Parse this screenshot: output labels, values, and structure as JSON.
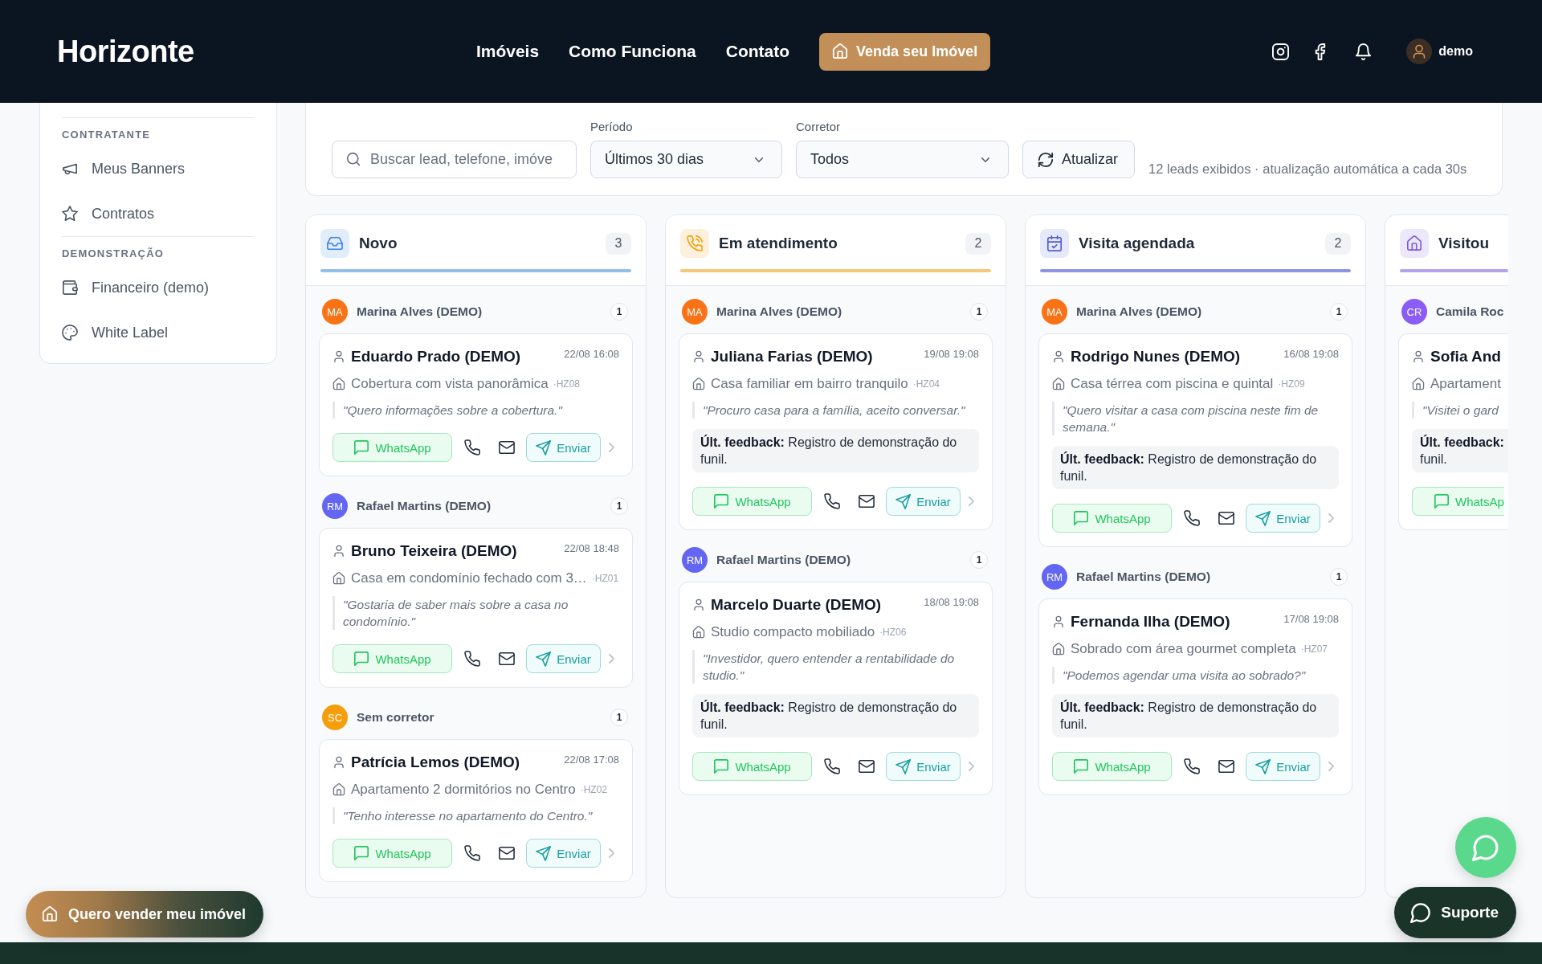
{
  "header": {
    "logo": "Horizonte",
    "nav": [
      {
        "label": "Imóveis"
      },
      {
        "label": "Como Funciona"
      },
      {
        "label": "Contato"
      }
    ],
    "cta": "Venda seu Imóvel",
    "user": "demo"
  },
  "sidebar": {
    "sections": [
      {
        "title": "CONTRATANTE",
        "items": [
          {
            "kind": "banners",
            "label": "Meus Banners"
          },
          {
            "kind": "contracts",
            "label": "Contratos"
          }
        ]
      },
      {
        "title": "DEMONSTRAÇÃO",
        "items": [
          {
            "kind": "finance",
            "label": "Financeiro (demo)"
          },
          {
            "kind": "branding",
            "label": "White Label"
          }
        ]
      }
    ]
  },
  "filters": {
    "search": {
      "placeholder": "Buscar lead, telefone, imóve"
    },
    "period": {
      "label": "Período",
      "value": "Últimos 30 dias"
    },
    "broker": {
      "label": "Corretor",
      "value": "Todos"
    },
    "refresh": "Atualizar",
    "info": "12 leads exibidos · atualização automática a cada 30s"
  },
  "board": {
    "columns": [
      {
        "kind": "new",
        "title": "Novo",
        "count": "3",
        "color": "#93bfe8",
        "groups": [
          {
            "initials": "MA",
            "color": "#f97316",
            "name": "Marina Alves (DEMO)",
            "count": "1",
            "leads": [
              {
                "name": "Eduardo Prado (DEMO)",
                "date": "22/08 16:08",
                "property": "Cobertura com vista panorâmica",
                "code": "·HZ08",
                "quote": "\"Quero informações sobre a cobertura.\"",
                "actions": [
                  {
                    "kind": "whatsapp",
                    "label": "WhatsApp"
                  },
                  {
                    "kind": "call"
                  },
                  {
                    "kind": "email"
                  },
                  {
                    "kind": "send",
                    "label": "Enviar"
                  },
                  {
                    "kind": "more"
                  }
                ]
              }
            ]
          },
          {
            "initials": "RM",
            "color": "#6366f1",
            "name": "Rafael Martins (DEMO)",
            "count": "1",
            "leads": [
              {
                "name": "Bruno Teixeira (DEMO)",
                "date": "22/08 18:48",
                "property": "Casa em condomínio fechado com 3…",
                "code": "·HZ01",
                "quote": "\"Gostaria de saber mais sobre a casa no condomínio.\"",
                "actions": [
                  {
                    "kind": "whatsapp",
                    "label": "WhatsApp"
                  },
                  {
                    "kind": "call"
                  },
                  {
                    "kind": "email"
                  },
                  {
                    "kind": "send",
                    "label": "Enviar"
                  },
                  {
                    "kind": "more"
                  }
                ]
              }
            ]
          },
          {
            "initials": "SC",
            "color": "#f59e0b",
            "name": "Sem corretor",
            "count": "1",
            "leads": [
              {
                "name": "Patrícia Lemos (DEMO)",
                "date": "22/08 17:08",
                "property": "Apartamento 2 dormitórios no Centro",
                "code": "·HZ02",
                "quote": "\"Tenho interesse no apartamento do Centro.\"",
                "actions": [
                  {
                    "kind": "whatsapp",
                    "label": "WhatsApp"
                  },
                  {
                    "kind": "call"
                  },
                  {
                    "kind": "email"
                  },
                  {
                    "kind": "send",
                    "label": "Enviar"
                  },
                  {
                    "kind": "more"
                  }
                ]
              }
            ]
          }
        ]
      },
      {
        "kind": "attending",
        "title": "Em atendimento",
        "count": "2",
        "color": "#f4c77b",
        "groups": [
          {
            "initials": "MA",
            "color": "#f97316",
            "name": "Marina Alves (DEMO)",
            "count": "1",
            "leads": [
              {
                "name": "Juliana Farias (DEMO)",
                "date": "19/08 19:08",
                "property": "Casa familiar em bairro tranquilo",
                "code": "·HZ04",
                "quote": "\"Procuro casa para a família, aceito conversar.\"",
                "feedback": "**Últ. feedback:** Registro de demonstração do funil.",
                "actions": [
                  {
                    "kind": "whatsapp",
                    "label": "WhatsApp"
                  },
                  {
                    "kind": "call"
                  },
                  {
                    "kind": "email"
                  },
                  {
                    "kind": "send",
                    "label": "Enviar"
                  },
                  {
                    "kind": "more"
                  }
                ]
              }
            ]
          },
          {
            "initials": "RM",
            "color": "#6366f1",
            "name": "Rafael Martins (DEMO)",
            "count": "1",
            "leads": [
              {
                "name": "Marcelo Duarte (DEMO)",
                "date": "18/08 19:08",
                "property": "Studio compacto mobiliado",
                "code": "·HZ06",
                "quote": "\"Investidor, quero entender a rentabilidade do studio.\"",
                "feedback": "**Últ. feedback:** Registro de demonstração do funil.",
                "actions": [
                  {
                    "kind": "whatsapp",
                    "label": "WhatsApp"
                  },
                  {
                    "kind": "call"
                  },
                  {
                    "kind": "email"
                  },
                  {
                    "kind": "send",
                    "label": "Enviar"
                  },
                  {
                    "kind": "more"
                  }
                ]
              }
            ]
          }
        ]
      },
      {
        "kind": "scheduled",
        "title": "Visita agendada",
        "count": "2",
        "color": "#8d95e3",
        "groups": [
          {
            "initials": "MA",
            "color": "#f97316",
            "name": "Marina Alves (DEMO)",
            "count": "1",
            "leads": [
              {
                "name": "Rodrigo Nunes (DEMO)",
                "date": "16/08 19:08",
                "property": "Casa térrea com piscina e quintal",
                "code": "·HZ09",
                "quote": "\"Quero visitar a casa com piscina neste fim de semana.\"",
                "feedback": "**Últ. feedback:** Registro de demonstração do funil.",
                "actions": [
                  {
                    "kind": "whatsapp",
                    "label": "WhatsApp"
                  },
                  {
                    "kind": "call"
                  },
                  {
                    "kind": "email"
                  },
                  {
                    "kind": "send",
                    "label": "Enviar"
                  },
                  {
                    "kind": "more"
                  }
                ]
              }
            ]
          },
          {
            "initials": "RM",
            "color": "#6366f1",
            "name": "Rafael Martins (DEMO)",
            "count": "1",
            "leads": [
              {
                "name": "Fernanda Ilha (DEMO)",
                "date": "17/08 19:08",
                "property": "Sobrado com área gourmet completa",
                "code": "·HZ07",
                "quote": "\"Podemos agendar uma visita ao sobrado?\"",
                "feedback": "**Últ. feedback:** Registro de demonstração do funil.",
                "actions": [
                  {
                    "kind": "whatsapp",
                    "label": "WhatsApp"
                  },
                  {
                    "kind": "call"
                  },
                  {
                    "kind": "email"
                  },
                  {
                    "kind": "send",
                    "label": "Enviar"
                  },
                  {
                    "kind": "more"
                  }
                ]
              }
            ]
          }
        ]
      },
      {
        "kind": "visited",
        "title": "Visitou",
        "color": "#b3a3ea",
        "groups": [
          {
            "initials": "CR",
            "color": "#8b5cf6",
            "name": "Camila Roc",
            "leads": [
              {
                "name": "Sofia And",
                "property": "Apartament",
                "quote": "\"Visitei o gard",
                "feedback": "**Últ. feedback:**\nfunil.",
                "actions": [
                  {
                    "kind": "whatsapp",
                    "label": "WhatsAp"
                  }
                ]
              }
            ]
          }
        ]
      }
    ]
  },
  "sell_button": "Quero vender meu imóvel",
  "support_button": "Suporte"
}
